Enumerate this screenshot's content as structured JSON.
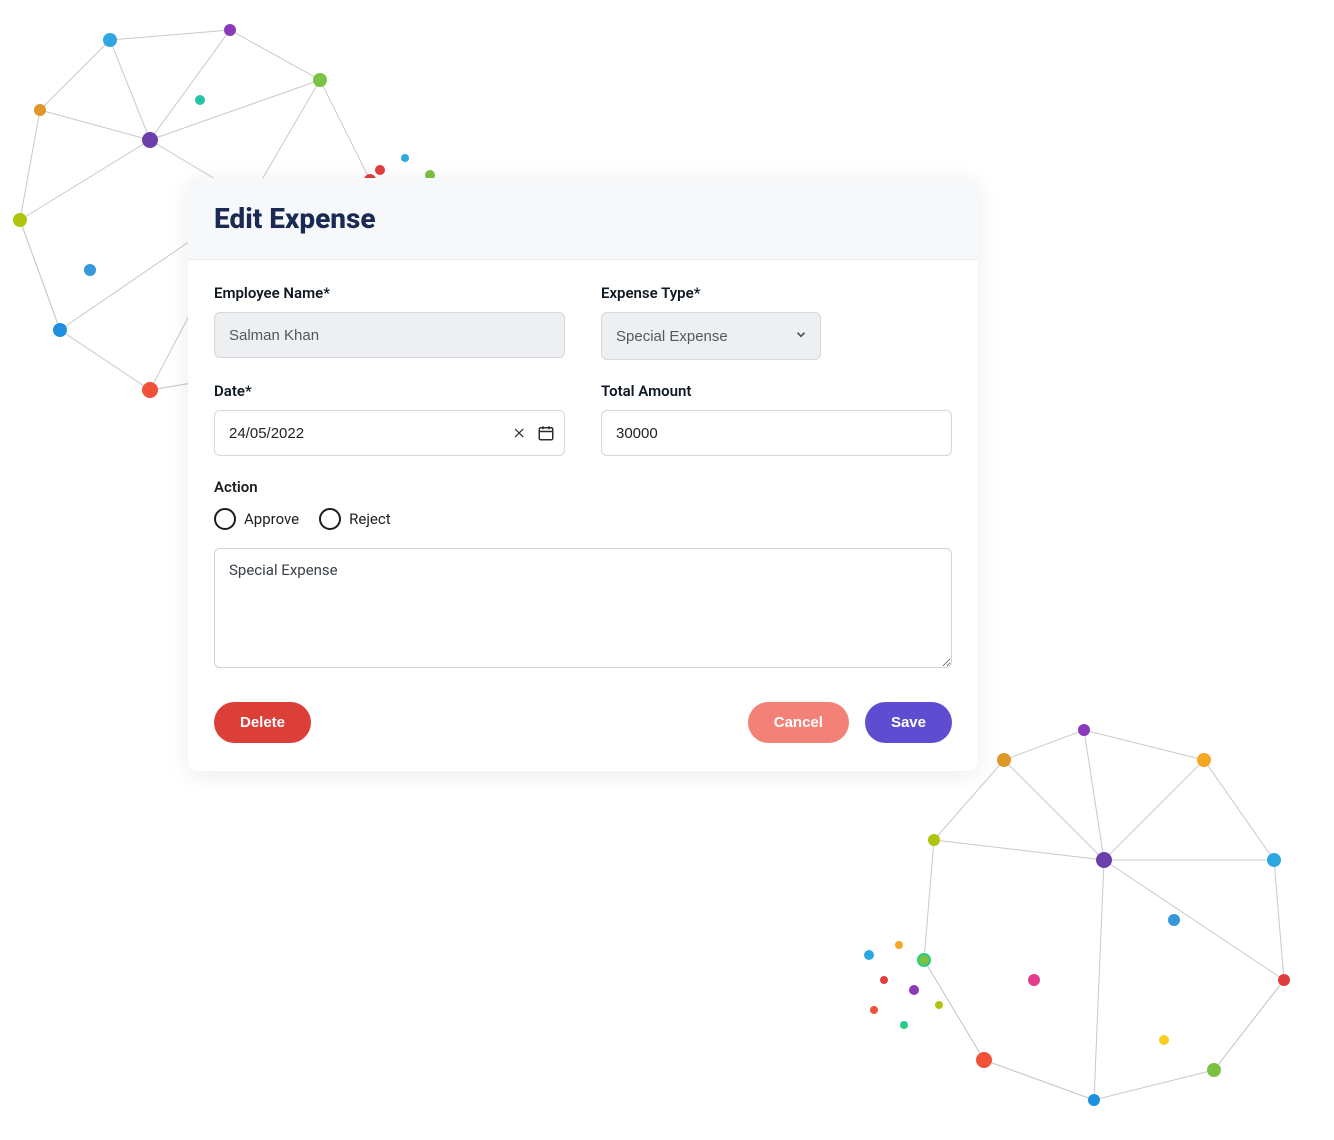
{
  "modal": {
    "title": "Edit Expense",
    "fields": {
      "employee_name": {
        "label": "Employee Name*",
        "value": "Salman Khan"
      },
      "expense_type": {
        "label": "Expense Type*",
        "value": "Special Expense"
      },
      "date": {
        "label": "Date*",
        "value": "24/05/2022"
      },
      "total_amount": {
        "label": "Total Amount",
        "value": "30000"
      }
    },
    "action": {
      "label": "Action",
      "options": {
        "approve": "Approve",
        "reject": "Reject"
      }
    },
    "notes": {
      "value": "Special Expense"
    },
    "buttons": {
      "delete": "Delete",
      "cancel": "Cancel",
      "save": "Save"
    }
  }
}
